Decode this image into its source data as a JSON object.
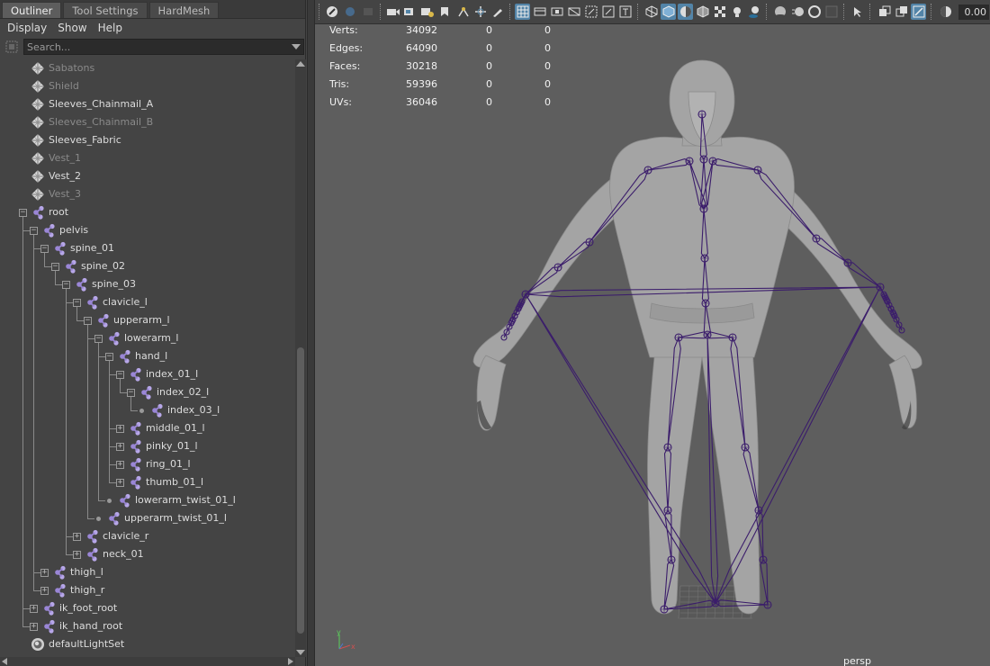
{
  "outliner": {
    "tabs": [
      "Outliner",
      "Tool Settings",
      "HardMesh"
    ],
    "active_tab": 0,
    "menus": [
      "Display",
      "Show",
      "Help"
    ],
    "search_placeholder": "Search...",
    "items": [
      {
        "label": "Sabatons",
        "type": "mesh",
        "depth": 0,
        "control": "none",
        "dim": true
      },
      {
        "label": "Shield",
        "type": "mesh",
        "depth": 0,
        "control": "none",
        "dim": true
      },
      {
        "label": "Sleeves_Chainmail_A",
        "type": "mesh",
        "depth": 0,
        "control": "none",
        "dim": false
      },
      {
        "label": "Sleeves_Chainmail_B",
        "type": "mesh",
        "depth": 0,
        "control": "none",
        "dim": true
      },
      {
        "label": "Sleeves_Fabric",
        "type": "mesh",
        "depth": 0,
        "control": "none",
        "dim": false
      },
      {
        "label": "Vest_1",
        "type": "mesh",
        "depth": 0,
        "control": "none",
        "dim": true
      },
      {
        "label": "Vest_2",
        "type": "mesh",
        "depth": 0,
        "control": "none",
        "dim": false
      },
      {
        "label": "Vest_3",
        "type": "mesh",
        "depth": 0,
        "control": "none",
        "dim": true
      },
      {
        "label": "root",
        "type": "joint",
        "depth": 0,
        "control": "minus",
        "dim": false
      },
      {
        "label": "pelvis",
        "type": "joint",
        "depth": 1,
        "control": "minus",
        "dim": false
      },
      {
        "label": "spine_01",
        "type": "joint",
        "depth": 2,
        "control": "minus",
        "dim": false
      },
      {
        "label": "spine_02",
        "type": "joint",
        "depth": 3,
        "control": "minus",
        "dim": false
      },
      {
        "label": "spine_03",
        "type": "joint",
        "depth": 4,
        "control": "minus",
        "dim": false
      },
      {
        "label": "clavicle_l",
        "type": "joint",
        "depth": 5,
        "control": "minus",
        "dim": false
      },
      {
        "label": "upperarm_l",
        "type": "joint",
        "depth": 6,
        "control": "minus",
        "dim": false
      },
      {
        "label": "lowerarm_l",
        "type": "joint",
        "depth": 7,
        "control": "minus",
        "dim": false
      },
      {
        "label": "hand_l",
        "type": "joint",
        "depth": 8,
        "control": "minus",
        "dim": false
      },
      {
        "label": "index_01_l",
        "type": "joint",
        "depth": 9,
        "control": "minus",
        "dim": false
      },
      {
        "label": "index_02_l",
        "type": "joint",
        "depth": 10,
        "control": "minus",
        "dim": false
      },
      {
        "label": "index_03_l",
        "type": "joint",
        "depth": 11,
        "control": "dot",
        "dim": false
      },
      {
        "label": "middle_01_l",
        "type": "joint",
        "depth": 9,
        "control": "plus",
        "dim": false
      },
      {
        "label": "pinky_01_l",
        "type": "joint",
        "depth": 9,
        "control": "plus",
        "dim": false
      },
      {
        "label": "ring_01_l",
        "type": "joint",
        "depth": 9,
        "control": "plus",
        "dim": false
      },
      {
        "label": "thumb_01_l",
        "type": "joint",
        "depth": 9,
        "control": "plus",
        "dim": false
      },
      {
        "label": "lowerarm_twist_01_l",
        "type": "joint",
        "depth": 8,
        "control": "dot",
        "dim": false
      },
      {
        "label": "upperarm_twist_01_l",
        "type": "joint",
        "depth": 7,
        "control": "dot",
        "dim": false
      },
      {
        "label": "clavicle_r",
        "type": "joint",
        "depth": 5,
        "control": "plus",
        "dim": false
      },
      {
        "label": "neck_01",
        "type": "joint",
        "depth": 5,
        "control": "plus",
        "dim": false
      },
      {
        "label": "thigh_l",
        "type": "joint",
        "depth": 2,
        "control": "plus",
        "dim": false
      },
      {
        "label": "thigh_r",
        "type": "joint",
        "depth": 2,
        "control": "plus",
        "dim": false
      },
      {
        "label": "ik_foot_root",
        "type": "joint",
        "depth": 1,
        "control": "plus",
        "dim": false
      },
      {
        "label": "ik_hand_root",
        "type": "joint",
        "depth": 1,
        "control": "plus",
        "dim": false
      },
      {
        "label": "defaultLightSet",
        "type": "set",
        "depth": 0,
        "control": "none",
        "dim": false
      }
    ]
  },
  "viewport": {
    "hud": [
      {
        "label": "Verts:",
        "values": [
          "34092",
          "0",
          "0"
        ]
      },
      {
        "label": "Edges:",
        "values": [
          "64090",
          "0",
          "0"
        ]
      },
      {
        "label": "Faces:",
        "values": [
          "30218",
          "0",
          "0"
        ]
      },
      {
        "label": "Tris:",
        "values": [
          "59396",
          "0",
          "0"
        ]
      },
      {
        "label": "UVs:",
        "values": [
          "36046",
          "0",
          "0"
        ]
      }
    ],
    "camera_label": "persp",
    "toolbar_value": "0.00",
    "axis_labels": [
      "y",
      "x",
      "z"
    ]
  },
  "colors": {
    "joint_icon": "#9a86d6",
    "skeleton": "#3b1d6b",
    "viewport_bg": "#5e5e5e",
    "mesh": "#a7a7a7",
    "highlight": "#5284a8"
  }
}
